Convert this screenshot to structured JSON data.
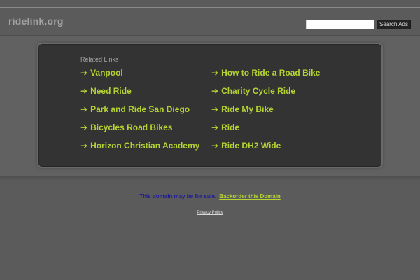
{
  "header": {
    "site_title": "ridelink.org",
    "search_placeholder": "",
    "search_button_label": "Search Ads"
  },
  "related": {
    "heading": "Related Links",
    "arrow": "➔",
    "left_links": [
      "Vanpool",
      "Need Ride",
      "Park and Ride San Diego",
      "Bicycles Road Bikes",
      "Horizon Christian Academy"
    ],
    "right_links": [
      "How to Ride a Road Bike",
      "Charity Cycle Ride",
      "Ride My Bike",
      "Ride",
      "Ride DH2 Wide"
    ]
  },
  "footer": {
    "sale_text": "This domain may be for sale.",
    "backorder_label": "Backorder this Domain",
    "privacy_label": "Privacy Policy"
  },
  "colors": {
    "background": "#5b5b5b",
    "panel": "#333333",
    "link_accent": "#b4d232",
    "sale_text": "#1a1aa0"
  }
}
